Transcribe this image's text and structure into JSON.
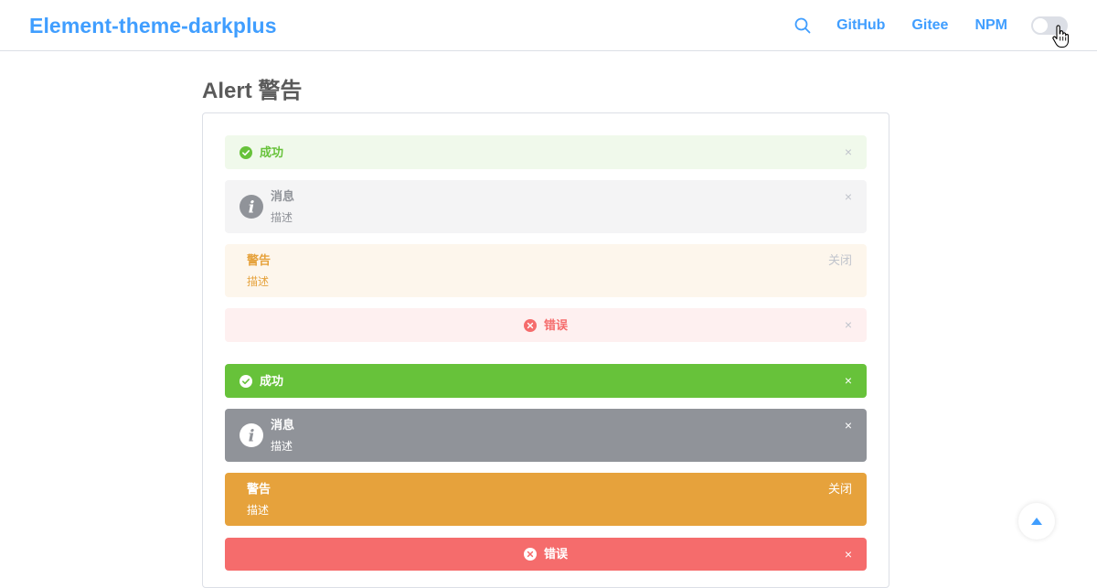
{
  "header": {
    "logo": "Element-theme-darkplus",
    "nav": [
      "GitHub",
      "Gitee",
      "NPM"
    ],
    "accent": "#409eff"
  },
  "page": {
    "title": "Alert 警告"
  },
  "alerts": {
    "light": [
      {
        "type": "success",
        "title": "成功",
        "description": "",
        "close": "×",
        "icon": "circle-check-icon"
      },
      {
        "type": "info",
        "title": "消息",
        "description": "描述",
        "close": "×",
        "icon": "info-icon"
      },
      {
        "type": "warning",
        "title": "警告",
        "description": "描述",
        "close": "关闭",
        "icon": ""
      },
      {
        "type": "error",
        "title": "错误",
        "description": "",
        "close": "×",
        "icon": "circle-close-icon"
      }
    ],
    "dark": [
      {
        "type": "success",
        "title": "成功",
        "description": "",
        "close": "×",
        "icon": "circle-check-icon"
      },
      {
        "type": "info",
        "title": "消息",
        "description": "描述",
        "close": "×",
        "icon": "info-icon"
      },
      {
        "type": "warning",
        "title": "警告",
        "description": "描述",
        "close": "关闭",
        "icon": ""
      },
      {
        "type": "error",
        "title": "错误",
        "description": "",
        "close": "×",
        "icon": "circle-close-icon"
      }
    ]
  },
  "colors": {
    "success": "#67c23a",
    "info": "#909399",
    "warning": "#e6a23c",
    "error": "#f56c6c"
  }
}
